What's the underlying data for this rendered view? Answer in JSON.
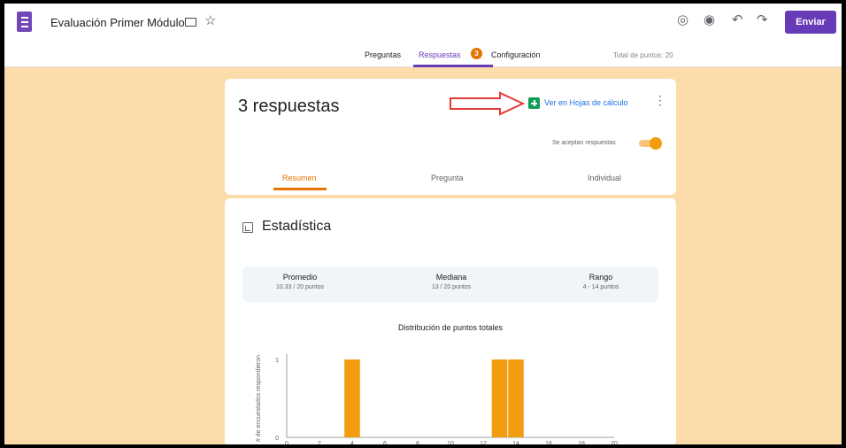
{
  "header": {
    "title": "Evaluación Primer Módulo",
    "send_label": "Enviar",
    "icons": [
      "forms-logo-icon",
      "folder-icon",
      "star-icon",
      "palette-icon",
      "preview-eye-icon",
      "undo-icon",
      "redo-icon"
    ]
  },
  "tabs": {
    "items": [
      {
        "label": "Preguntas"
      },
      {
        "label": "Respuestas",
        "active": true
      },
      {
        "label": "Configuración"
      }
    ],
    "badge": "3",
    "total_points": "Total de puntos: 20"
  },
  "responses": {
    "title": "3 respuestas",
    "sheets_link": "Ver en Hojas de cálculo",
    "accepting_label": "Se aceptan respuestas",
    "accepting": true,
    "subtabs": [
      {
        "label": "Resumen",
        "active": true
      },
      {
        "label": "Pregunta"
      },
      {
        "label": "Individual"
      }
    ]
  },
  "stats": {
    "title": "Estadística",
    "items": [
      {
        "name": "Promedio",
        "value": "10.33 / 20 puntos"
      },
      {
        "name": "Mediana",
        "value": "13 / 20 puntos"
      },
      {
        "name": "Rango",
        "value": "4 - 14 puntos"
      }
    ]
  },
  "colors": {
    "accent": "#673ab7",
    "highlight": "#f29d0f",
    "background": "#fbdcaa"
  },
  "chart_data": {
    "type": "bar",
    "title": "Distribución de puntos totales",
    "ylabel": "# de encuestados respondieron",
    "xlabel": "",
    "x_ticks": [
      "0",
      "2",
      "4",
      "6",
      "8",
      "10",
      "12",
      "14",
      "16",
      "18",
      "20"
    ],
    "y_ticks": [
      "0",
      "1"
    ],
    "categories": [
      "4",
      "13",
      "14"
    ],
    "values": [
      1,
      1,
      1
    ],
    "xlim": [
      0,
      20
    ],
    "ylim": [
      0,
      1
    ]
  }
}
